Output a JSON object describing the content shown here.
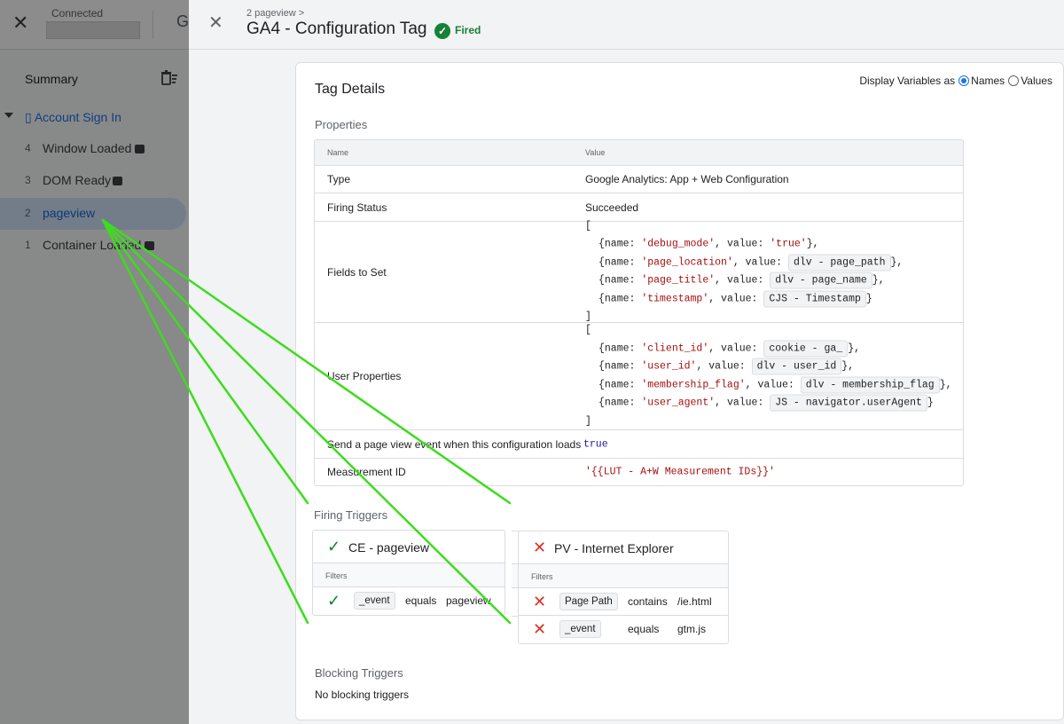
{
  "background": {
    "connected_label": "Connected",
    "tab_letter": "G",
    "summary_label": "Summary",
    "account_label": "▯ Account Sign In",
    "events": [
      {
        "num": "4",
        "label": "Window Loaded"
      },
      {
        "num": "3",
        "label": "DOM Ready"
      },
      {
        "num": "2",
        "label": "pageview"
      },
      {
        "num": "1",
        "label": "Container Loaded"
      }
    ]
  },
  "panel": {
    "breadcrumb": "2 pageview >",
    "title": "GA4 - Configuration Tag",
    "status": "Fired",
    "card_title": "Tag Details",
    "display_vars_label": "Display Variables as",
    "display_vars_options": [
      "Names",
      "Values"
    ],
    "display_vars_selected": "Names",
    "properties_label": "Properties",
    "table_header": {
      "name": "Name",
      "value": "Value"
    },
    "rows": {
      "type": {
        "name": "Type",
        "value": "Google Analytics: App + Web Configuration"
      },
      "firing_status": {
        "name": "Firing Status",
        "value": "Succeeded"
      },
      "fields_to_set": {
        "name": "Fields to Set",
        "open": "[",
        "close": "]",
        "items": [
          {
            "key": "'debug_mode'",
            "value": "'true'",
            "chip": false
          },
          {
            "key": "'page_location'",
            "value": "dlv - page_path",
            "chip": true
          },
          {
            "key": "'page_title'",
            "value": "dlv - page_name",
            "chip": true
          },
          {
            "key": "'timestamp'",
            "value": "CJS - Timestamp",
            "chip": true
          }
        ]
      },
      "user_properties": {
        "name": "User Properties",
        "open": "[",
        "close": "]",
        "items": [
          {
            "key": "'client_id'",
            "value": "cookie - ga_",
            "chip": true
          },
          {
            "key": "'user_id'",
            "value": "dlv - user_id",
            "chip": true
          },
          {
            "key": "'membership_flag'",
            "value": "dlv - membership_flag",
            "chip": true
          },
          {
            "key": "'user_agent'",
            "value": "JS - navigator.userAgent",
            "chip": true
          }
        ]
      },
      "send_page_view": {
        "name": "Send a page view event when this configuration loads",
        "value": "true"
      },
      "measurement_id": {
        "name": "Measurement ID",
        "value": "'{{LUT - A+W Measurement IDs}}'"
      }
    },
    "code": {
      "name_prefix": "{name: ",
      "value_prefix": ", value: ",
      "close": "}",
      "sep": ","
    },
    "firing_triggers_label": "Firing Triggers",
    "filters_label": "Filters",
    "triggers": [
      {
        "name": "CE - pageview",
        "status": "pass",
        "filters": [
          {
            "variable": "_event",
            "operator": "equals",
            "value": "pageview",
            "status": "pass"
          }
        ]
      },
      {
        "name": "PV - Internet Explorer",
        "status": "fail",
        "filters": [
          {
            "variable": "Page Path",
            "operator": "contains",
            "value": "/ie.html",
            "status": "fail"
          },
          {
            "variable": "_event",
            "operator": "equals",
            "value": "gtm.js",
            "status": "fail"
          }
        ]
      }
    ],
    "blocking_triggers_label": "Blocking Triggers",
    "blocking_triggers_none": "No blocking triggers"
  },
  "colors": {
    "fired_green": "#188038",
    "fail_red": "#d93025",
    "accent_blue": "#1a73e8",
    "annotation_arrow": "#3ddc1e"
  },
  "icons": {
    "close": "✕",
    "check": "✓",
    "cross": "✕"
  }
}
